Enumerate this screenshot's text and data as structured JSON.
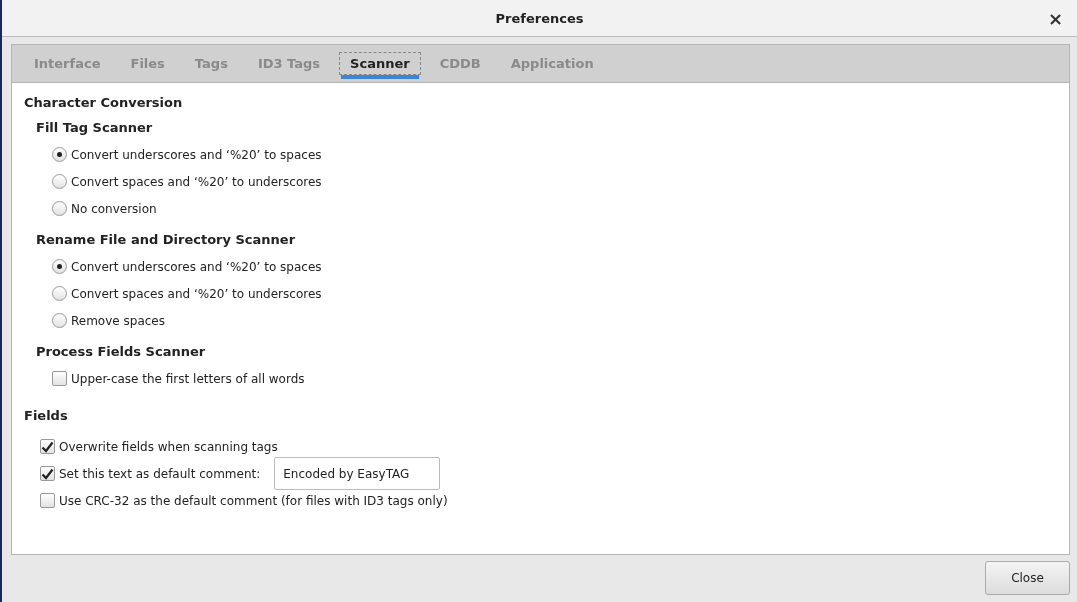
{
  "window": {
    "title": "Preferences",
    "close": "×"
  },
  "tabs": [
    {
      "label": "Interface",
      "selected": false
    },
    {
      "label": "Files",
      "selected": false
    },
    {
      "label": "Tags",
      "selected": false
    },
    {
      "label": "ID3 Tags",
      "selected": false
    },
    {
      "label": "Scanner",
      "selected": true
    },
    {
      "label": "CDDB",
      "selected": false
    },
    {
      "label": "Application",
      "selected": false
    }
  ],
  "sections": [
    {
      "title": "Character Conversion",
      "groups": [
        {
          "title": "Fill Tag Scanner",
          "options": [
            {
              "kind": "radio",
              "label": "Convert underscores and ‘%20’ to spaces",
              "selected": true
            },
            {
              "kind": "radio",
              "label": "Convert spaces and ‘%20’ to underscores",
              "selected": false
            },
            {
              "kind": "radio",
              "label": "No conversion",
              "selected": false
            }
          ]
        },
        {
          "title": "Rename File and Directory Scanner",
          "options": [
            {
              "kind": "radio",
              "label": "Convert underscores and ‘%20’ to spaces",
              "selected": true
            },
            {
              "kind": "radio",
              "label": "Convert spaces and ‘%20’ to underscores",
              "selected": false
            },
            {
              "kind": "radio",
              "label": "Remove spaces",
              "selected": false
            }
          ]
        },
        {
          "title": "Process Fields Scanner",
          "options": [
            {
              "kind": "checkbox",
              "label": "Upper-case the first letters of all words",
              "checked": false
            }
          ]
        }
      ]
    },
    {
      "title": "Fields",
      "groups": [
        {
          "options": [
            {
              "kind": "checkbox",
              "label": "Overwrite fields when scanning tags",
              "checked": true
            },
            {
              "kind": "checkbox",
              "label": "Set this text as default comment:",
              "checked": true,
              "value": "Encoded by EasyTAG"
            },
            {
              "kind": "checkbox",
              "label": "Use CRC-32 as the default comment (for files with ID3 tags only)",
              "checked": false
            }
          ]
        }
      ]
    }
  ],
  "buttons": [
    "Close"
  ]
}
